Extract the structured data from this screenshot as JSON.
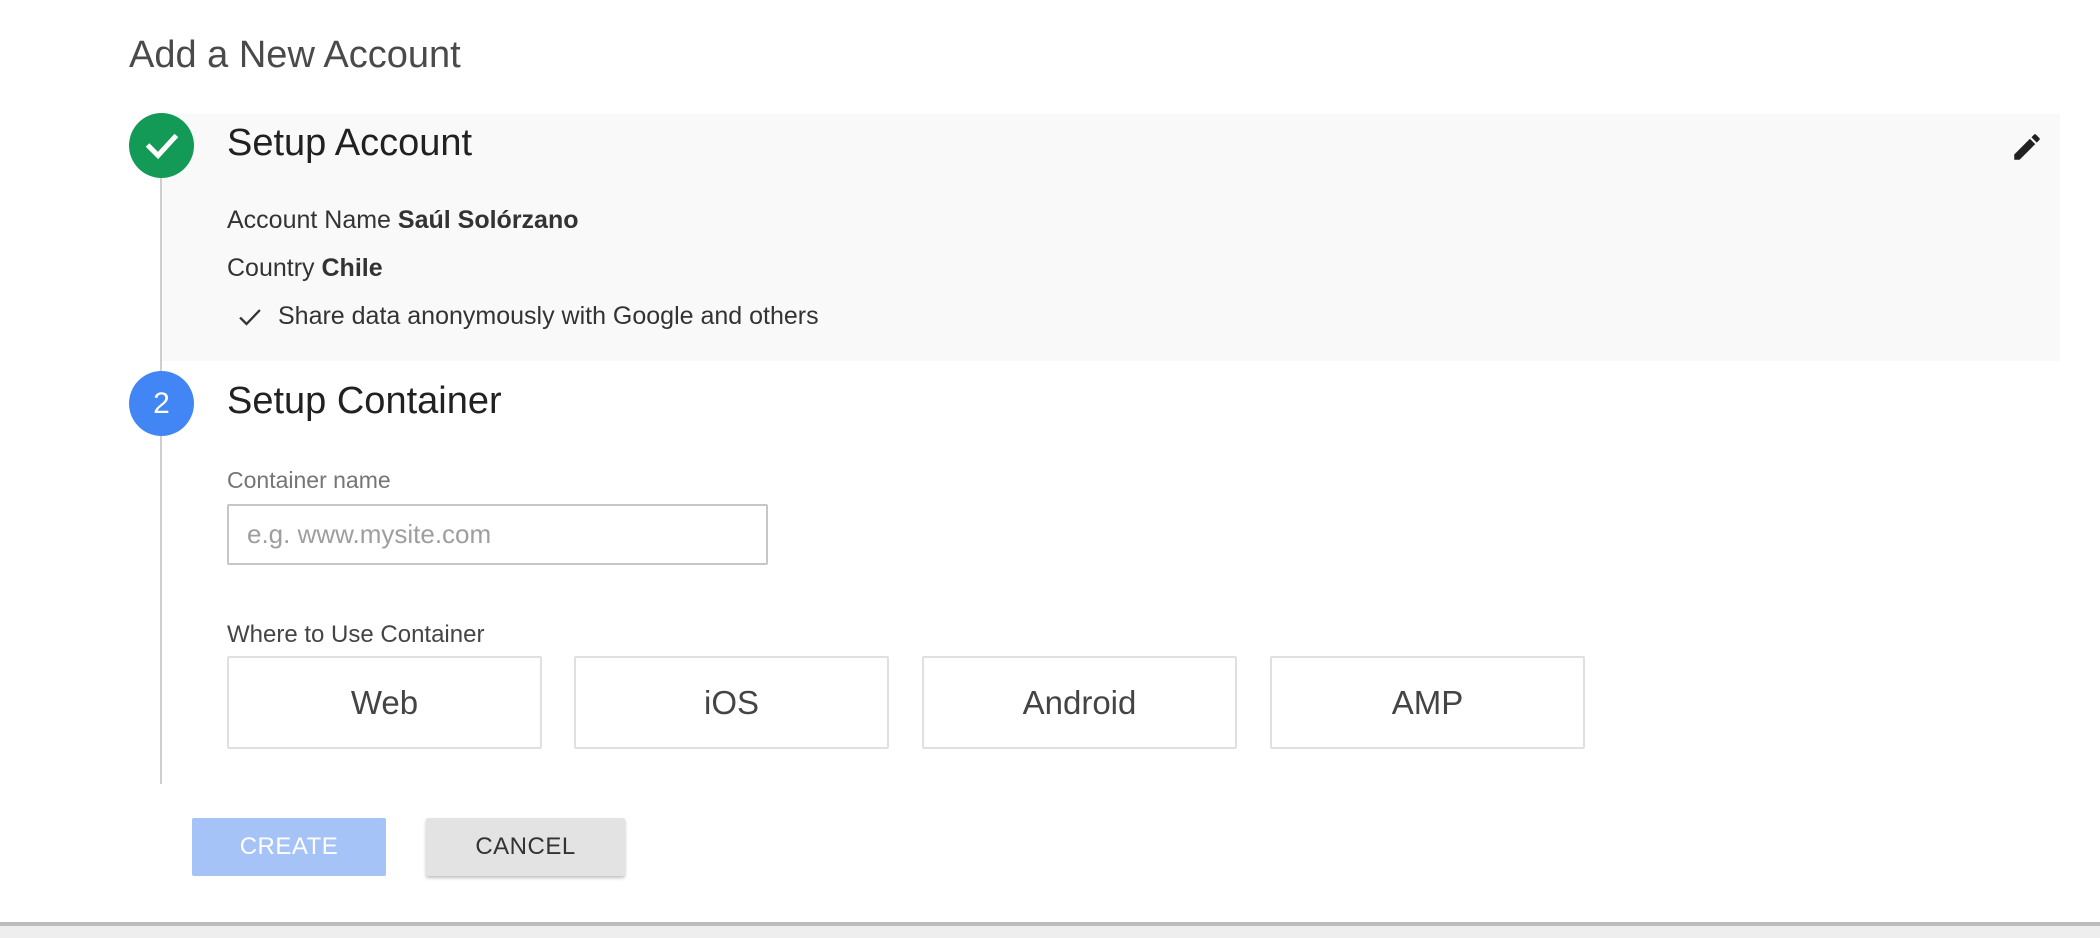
{
  "page": {
    "title": "Add a New Account"
  },
  "step1": {
    "number_icon": "check-icon",
    "title": "Setup Account",
    "account_name_label": "Account Name",
    "account_name_value": "Saúl Solórzano",
    "country_label": "Country",
    "country_value": "Chile",
    "share_data_text": "Share data anonymously with Google and others",
    "edit_icon": "pencil-icon",
    "status_color": "#139a57"
  },
  "step2": {
    "number": "2",
    "title": "Setup Container",
    "status_color": "#4285f4",
    "container_name_label": "Container name",
    "container_name_placeholder": "e.g. www.mysite.com",
    "container_name_value": "",
    "where_label": "Where to Use Container",
    "platforms": [
      {
        "label": "Web"
      },
      {
        "label": "iOS"
      },
      {
        "label": "Android"
      },
      {
        "label": "AMP"
      }
    ]
  },
  "actions": {
    "create_label": "CREATE",
    "create_disabled": true,
    "cancel_label": "CANCEL"
  }
}
